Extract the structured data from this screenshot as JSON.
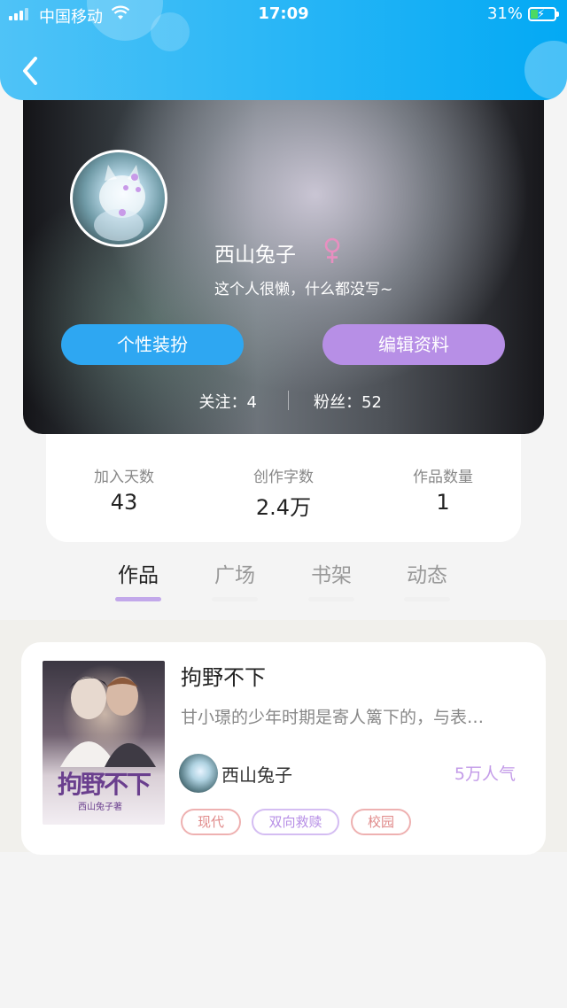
{
  "status_bar": {
    "carrier": "中国移动",
    "time": "17:09",
    "battery_percent": "31%",
    "battery_level": 0.31,
    "icons": [
      "signal-icon",
      "wifi-icon",
      "battery-charging-icon"
    ]
  },
  "header": {
    "back_icon": "chevron-left-icon",
    "accent_color": "#29b6f6"
  },
  "profile": {
    "username": "西山兔子",
    "gender_icon": "female-icon",
    "gender_color": "#e88fc0",
    "bio": "这个人很懒，什么都没写~",
    "buttons": {
      "dress_up": "个性装扮",
      "edit_profile": "编辑资料"
    },
    "following_text": "关注：4",
    "followers_text": "粉丝：52"
  },
  "stats": [
    {
      "label": "加入天数",
      "value": "43"
    },
    {
      "label": "创作字数",
      "value": "2.4万"
    },
    {
      "label": "作品数量",
      "value": "1"
    }
  ],
  "tabs": [
    {
      "label": "作品",
      "active": true
    },
    {
      "label": "广场",
      "active": false
    },
    {
      "label": "书架",
      "active": false
    },
    {
      "label": "动态",
      "active": false
    }
  ],
  "works": [
    {
      "title": "拘野不下",
      "cover_title": "拘野不下",
      "cover_author": "西山兔子著",
      "description": "甘小璟的少年时期是寄人篱下的，与表…",
      "author": "西山兔子",
      "popularity": "5万人气",
      "tags": [
        "现代",
        "双向救赎",
        "校园"
      ]
    }
  ]
}
